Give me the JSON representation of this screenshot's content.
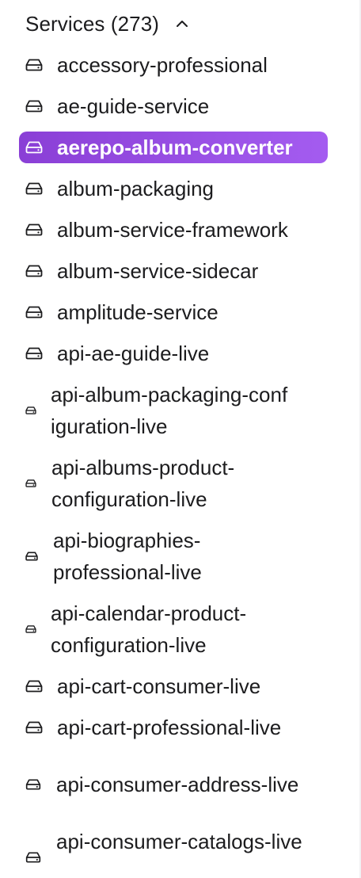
{
  "header": {
    "title": "Services (273)",
    "expand_icon": "chevron-up-icon"
  },
  "icon": "drive-icon",
  "accent_color": "#9a4fe6",
  "selected_text_color": "#ffffff",
  "services": [
    {
      "label": "accessory-professional",
      "selected": false
    },
    {
      "label": "ae-guide-service",
      "selected": false
    },
    {
      "label": "aerepo-album-converter",
      "selected": true
    },
    {
      "label": "album-packaging",
      "selected": false
    },
    {
      "label": "album-service-framework",
      "selected": false
    },
    {
      "label": "album-service-sidecar",
      "selected": false
    },
    {
      "label": "amplitude-service",
      "selected": false
    },
    {
      "label": "api-ae-guide-live",
      "selected": false
    },
    {
      "label": "api-album-packaging-configuration-live",
      "selected": false
    },
    {
      "label": "api-albums-product-configuration-live",
      "selected": false
    },
    {
      "label": "api-biographies-professional-live",
      "selected": false
    },
    {
      "label": "api-calendar-product-configuration-live",
      "selected": false
    },
    {
      "label": "api-cart-consumer-live",
      "selected": false
    },
    {
      "label": "api-cart-professional-live",
      "selected": false
    },
    {
      "label": "api-consumer-address-live",
      "selected": false
    },
    {
      "label": "api-consumer-catalogs-live",
      "selected": false
    }
  ]
}
